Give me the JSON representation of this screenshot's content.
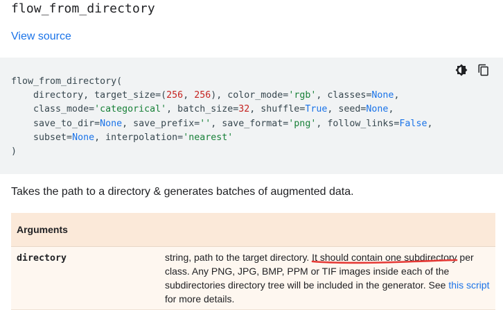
{
  "header": {
    "title": "flow_from_directory",
    "view_source": "View source"
  },
  "code": {
    "line1": "flow_from_directory(",
    "line2": {
      "p1": "    directory, target_size=(",
      "n1": "256",
      "p2": ", ",
      "n2": "256",
      "p3": "), color_mode=",
      "s1": "'rgb'",
      "p4": ", classes=",
      "k1": "None",
      "p5": ","
    },
    "line3": {
      "p1": "    class_mode=",
      "s1": "'categorical'",
      "p2": ", batch_size=",
      "n1": "32",
      "p3": ", shuffle=",
      "k1": "True",
      "p4": ", seed=",
      "k2": "None",
      "p5": ","
    },
    "line4": {
      "p1": "    save_to_dir=",
      "k1": "None",
      "p2": ", save_prefix=",
      "s1": "''",
      "p3": ", save_format=",
      "s2": "'png'",
      "p4": ", follow_links=",
      "k2": "False",
      "p5": ","
    },
    "line5": {
      "p1": "    subset=",
      "k1": "None",
      "p2": ", interpolation=",
      "s1": "'nearest'"
    },
    "line6": ")"
  },
  "icons": {
    "theme": "dark-mode-icon",
    "copy": "copy-icon"
  },
  "description": "Takes the path to a directory & generates batches of augmented data.",
  "arguments": {
    "header": "Arguments",
    "rows": [
      {
        "name": "directory",
        "desc_before": "string, path to the target directory. It should contain one subdirectory per class. Any PNG, JPG, BMP, PPM or TIF images inside each of the subdirectories directory tree will be included in the generator. See ",
        "link": "this script",
        "desc_after": " for more details."
      }
    ]
  },
  "colors": {
    "link": "#1a73e8",
    "code_bg": "#f1f3f4",
    "table_header_bg": "#fbe9d9",
    "annotation": "#e53935"
  }
}
